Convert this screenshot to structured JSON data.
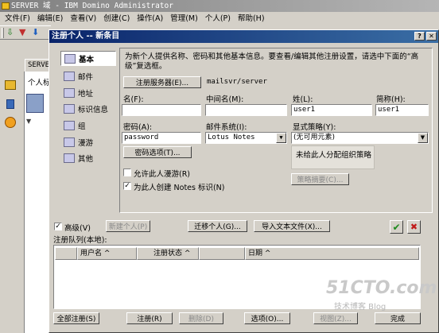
{
  "app": {
    "title": "SERVER 域 - IBM Domino Administrator",
    "menu": [
      "文件(F)",
      "编辑(E)",
      "查看(V)",
      "创建(C)",
      "操作(A)",
      "管理(M)",
      "个人(P)",
      "帮助(H)"
    ],
    "bg_tab_label": "SERVE",
    "bg_panel_text": "个人标"
  },
  "dialog": {
    "title": "注册个人 -- 新条目",
    "nav": [
      {
        "label": "基本",
        "icon": "person-icon"
      },
      {
        "label": "邮件",
        "icon": "mail-icon"
      },
      {
        "label": "地址",
        "icon": "address-icon"
      },
      {
        "label": "标识信息",
        "icon": "id-info-icon"
      },
      {
        "label": "组",
        "icon": "group-icon"
      },
      {
        "label": "漫游",
        "icon": "roaming-icon"
      },
      {
        "label": "其他",
        "icon": "other-icon"
      }
    ],
    "info_text": "为新个人提供名称、密码和其他基本信息。要查看/编辑其他注册设置，请选中下面的“高级”复选框。",
    "register_server_button": "注册服务器(E)...",
    "server_value": "mailsvr/server",
    "fields": {
      "first_name_label": "名(F):",
      "first_name_value": "",
      "middle_name_label": "中间名(M):",
      "middle_name_value": "",
      "last_name_label": "姓(L):",
      "last_name_value": "user1",
      "short_name_label": "简称(H):",
      "short_name_value": "user1",
      "password_label": "密码(A):",
      "password_value": "password",
      "mail_system_label": "邮件系统(I):",
      "mail_system_value": "Lotus Notes",
      "policy_label": "显式策略(Y):",
      "policy_value": "(无可用元素)"
    },
    "password_options_button": "密码选项(T)...",
    "policy_note": "未给此人分配组织策略",
    "policy_summary_button": "策略摘要(C)...",
    "allow_roaming_label": "允许此人漫游(R)",
    "allow_roaming_checked": false,
    "create_notes_id_label": "为此人创建 Notes 标识(N)",
    "create_notes_id_checked": true,
    "advanced_label": "高级(V)",
    "advanced_checked": true,
    "new_person_button": "新建个人(P)",
    "migrate_button": "迁移个人(G)...",
    "import_button": "导入文本文件(X)...",
    "confirm_symbol": "✔",
    "cancel_symbol": "✖",
    "queue_label": "注册队列(本地):",
    "queue_columns": [
      "用户名 ^",
      "注册状态 ^",
      "日期 ^"
    ],
    "bottom_buttons": {
      "register_all": "全部注册(S)",
      "register": "注册(R)",
      "delete": "删除(D)",
      "options": "选项(O)...",
      "view": "视图(Z)...",
      "done": "完成"
    }
  },
  "watermark": {
    "logo": "51CTO.com",
    "blog": "技术博客 Blog"
  },
  "colors": {
    "titlebar": "#848284",
    "dialog_title": "#0a246a",
    "face": "#d4d0c8",
    "check_green": "#1e8a1e",
    "cross_red": "#c01818"
  }
}
